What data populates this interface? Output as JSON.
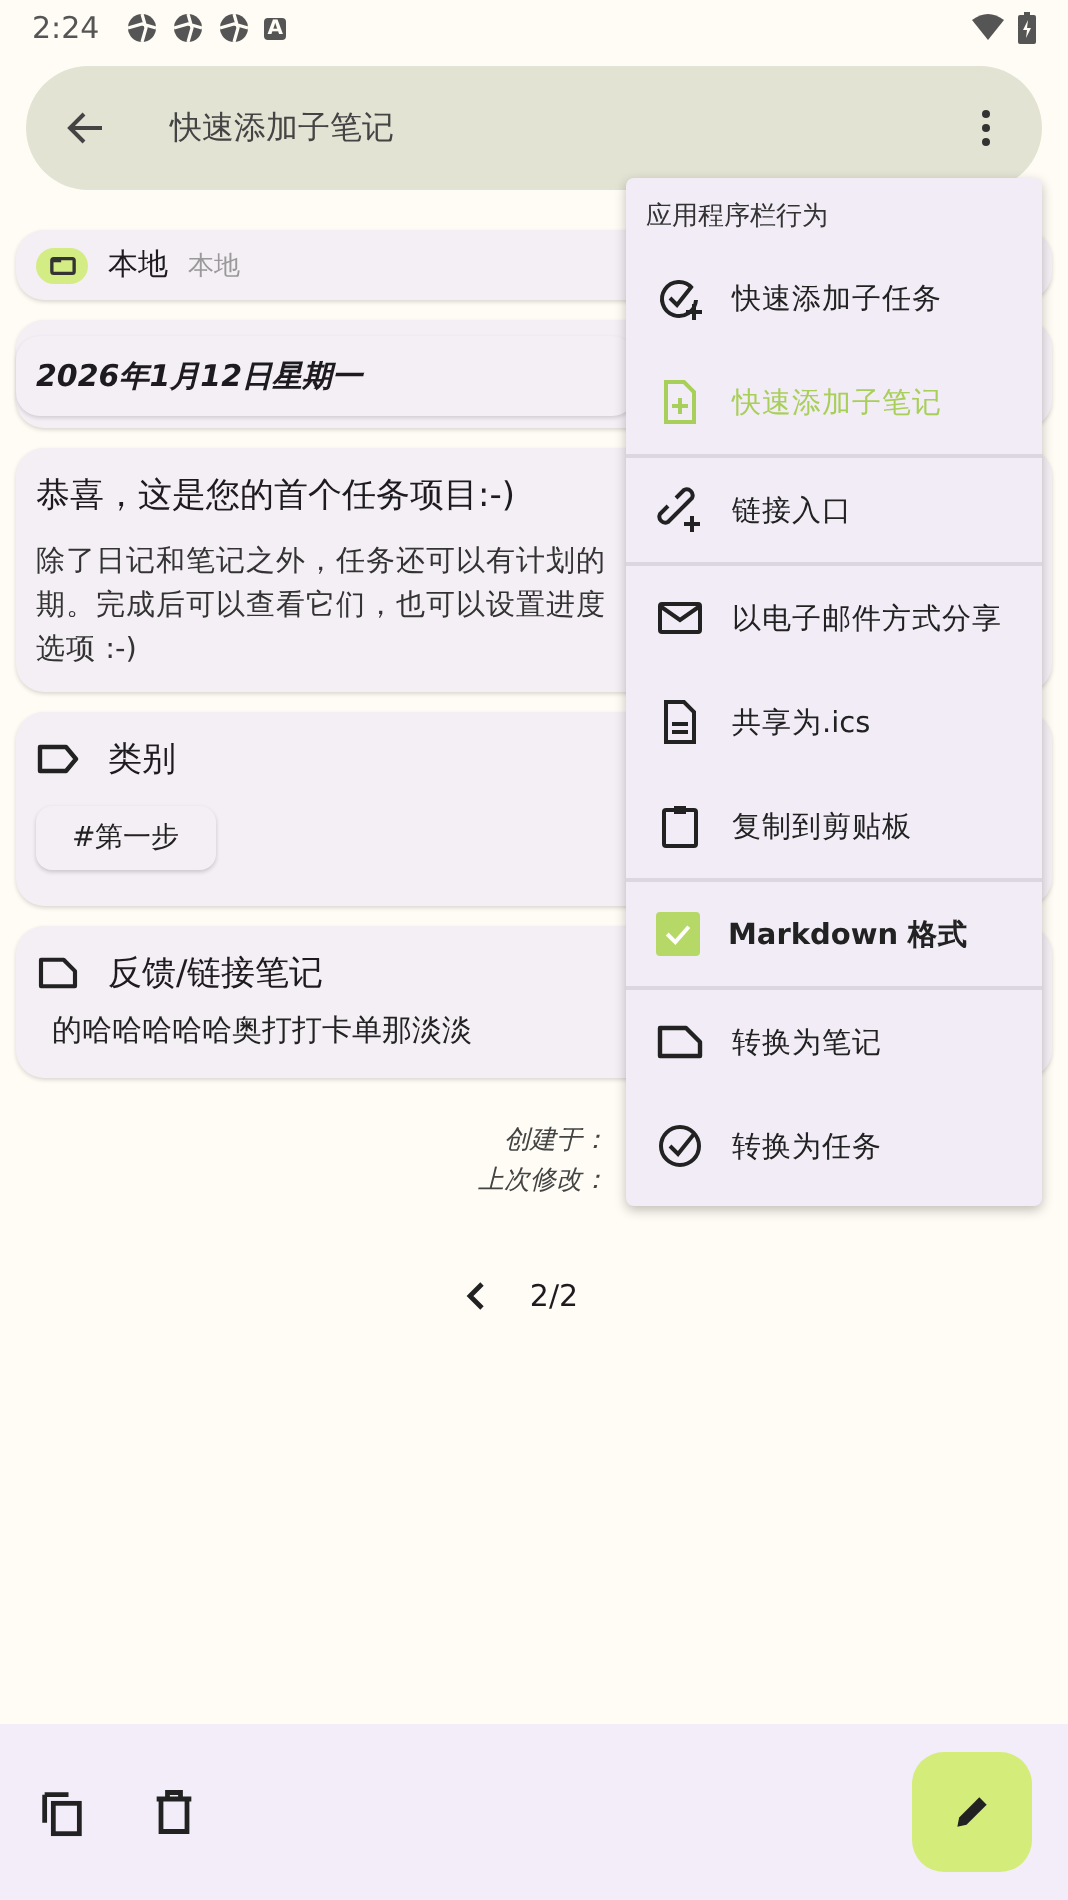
{
  "status_bar": {
    "time": "2:24",
    "notification_letter": "A"
  },
  "top_bar": {
    "title": "快速添加子笔记"
  },
  "collection": {
    "name": "本地",
    "account": "本地"
  },
  "date": "2026年1月12日星期一",
  "task": {
    "title": "恭喜，这是您的首个任务项目:-)",
    "description": "除了日记和笔记之外，任务还可以有计划的期。完成后可以查看它们，也可以设置进度选项 :-)"
  },
  "categories": {
    "title": "类别",
    "tags": [
      "#第一步"
    ]
  },
  "feedback": {
    "title": "反馈/链接笔记",
    "items": [
      "的哈哈哈哈哈奥打打卡单那淡淡"
    ]
  },
  "meta": {
    "created": "创建于：",
    "modified": "上次修改："
  },
  "pager": {
    "label": "2/2"
  },
  "menu": {
    "header": "应用程序栏行为",
    "items": [
      {
        "kind": "action",
        "label": "快速添加子任务",
        "active": false,
        "divider_after": false
      },
      {
        "kind": "action",
        "label": "快速添加子笔记",
        "active": true,
        "divider_after": true
      },
      {
        "kind": "action",
        "label": "链接入口",
        "active": false,
        "divider_after": true
      },
      {
        "kind": "action",
        "label": "以电子邮件方式分享",
        "active": false,
        "divider_after": false
      },
      {
        "kind": "action",
        "label": "共享为.ics",
        "active": false,
        "divider_after": false
      },
      {
        "kind": "action",
        "label": "复制到剪贴板",
        "active": false,
        "divider_after": true
      },
      {
        "kind": "checkbox",
        "label": "Markdown 格式",
        "checked": true,
        "divider_after": true
      },
      {
        "kind": "action",
        "label": "转换为笔记",
        "active": false,
        "divider_after": false
      },
      {
        "kind": "action",
        "label": "转换为任务",
        "active": false,
        "divider_after": false
      }
    ]
  }
}
